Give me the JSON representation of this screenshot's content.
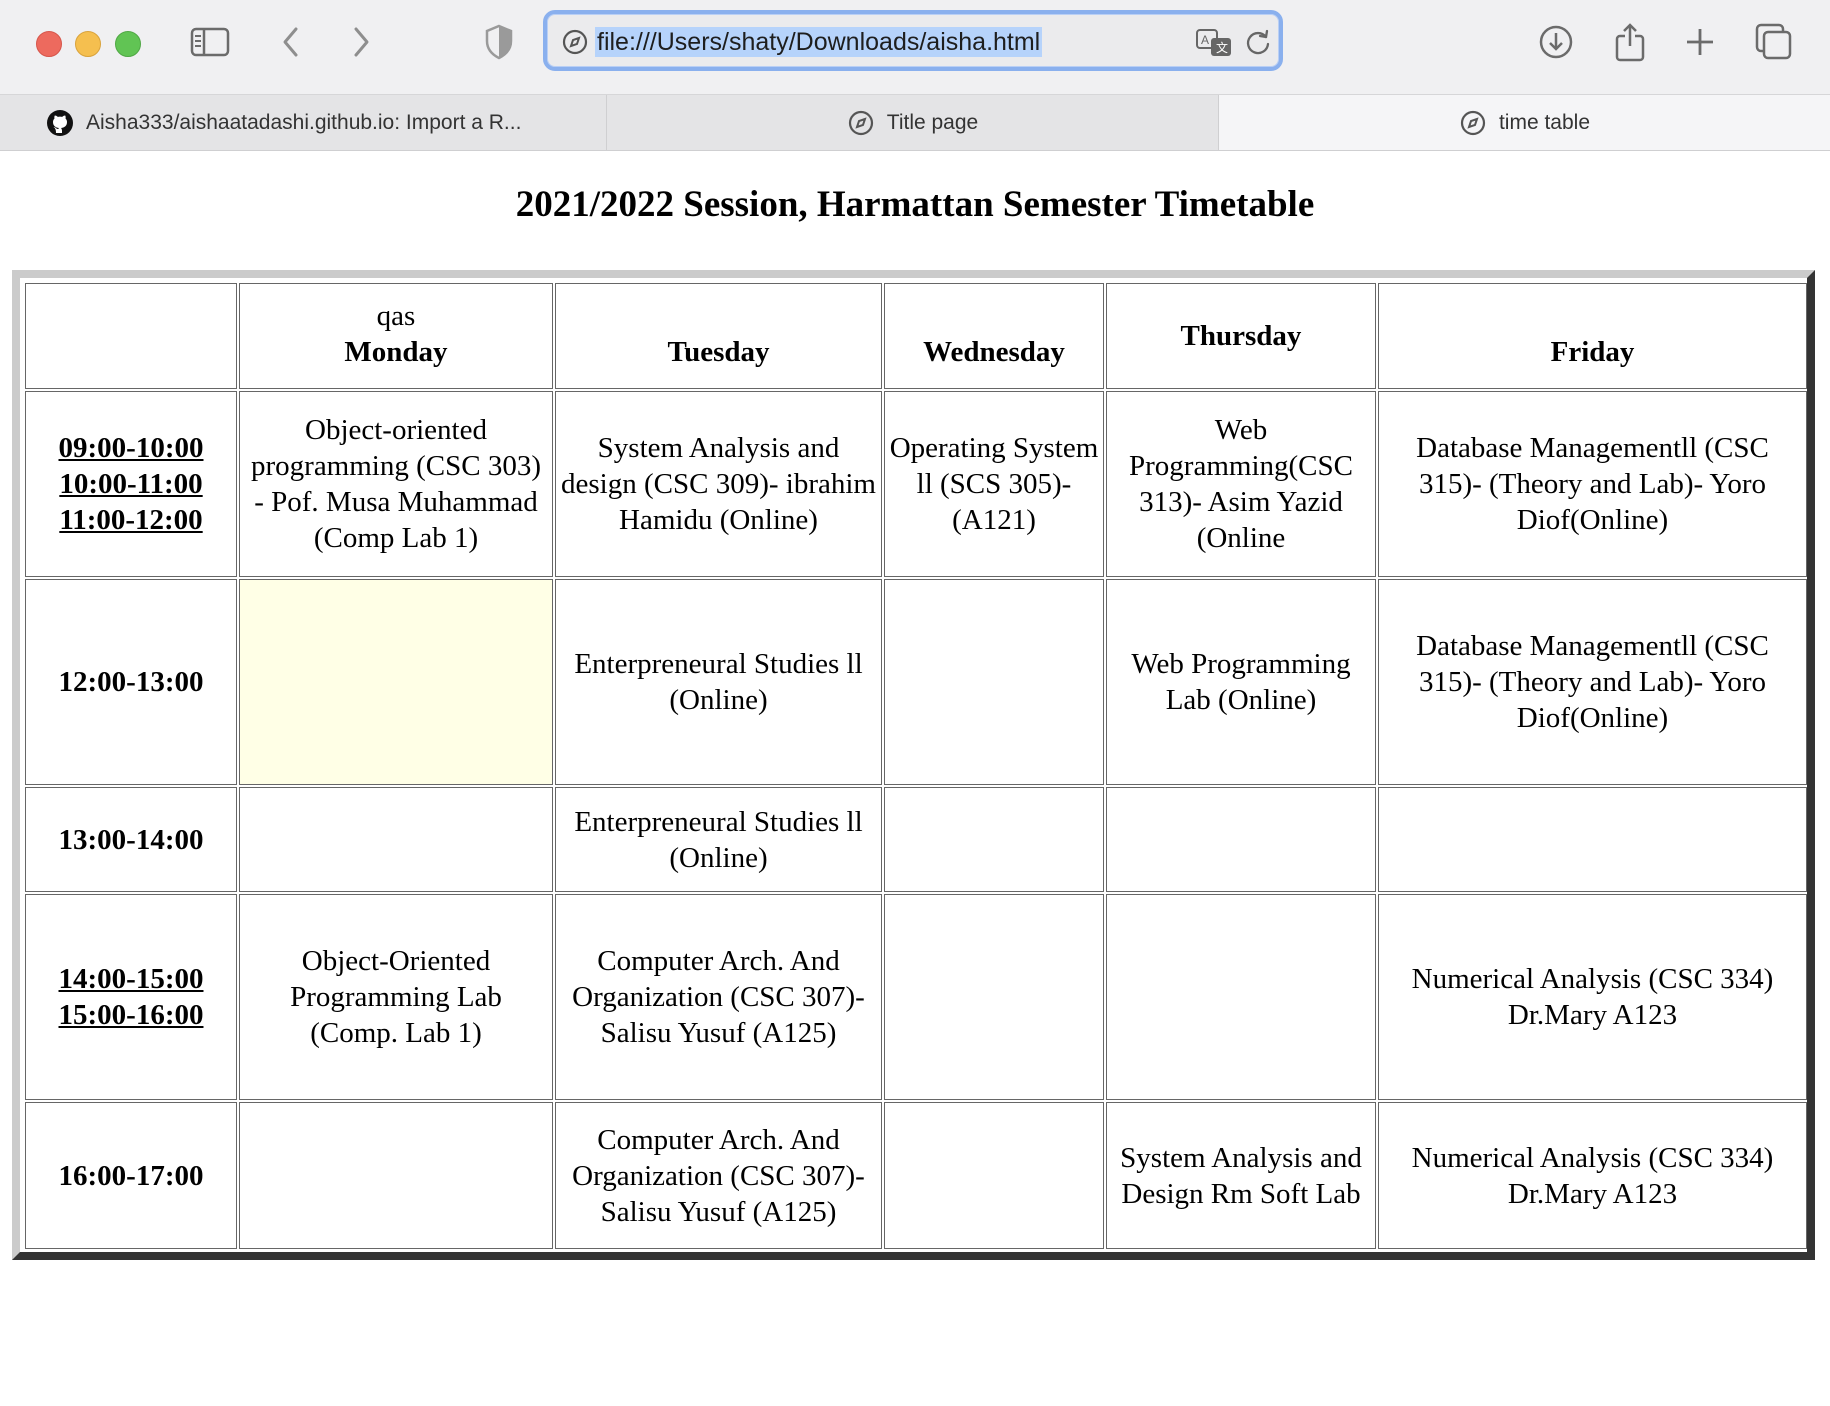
{
  "browser": {
    "url": "file:///Users/shaty/Downloads/aisha.html",
    "tabs": [
      {
        "label": "Aisha333/aishaatadashi.github.io: Import a R...",
        "icon": "github-icon",
        "active": false
      },
      {
        "label": "Title page",
        "icon": "compass-icon",
        "active": false
      },
      {
        "label": "time table",
        "icon": "compass-icon",
        "active": true
      }
    ]
  },
  "page": {
    "title": "2021/2022 Session, Harmattan Semester Timetable",
    "header": {
      "blank": "",
      "monday_note": "qas",
      "monday": "Monday",
      "tuesday": "Tuesday",
      "wednesday": "Wednesday",
      "thursday": "Thursday",
      "friday": "Friday"
    },
    "rows": [
      {
        "times": [
          "09:00-10:00",
          "10:00-11:00",
          "11:00-12:00"
        ],
        "linked": true,
        "cells": [
          "Object-oriented programming (CSC 303) - Pof. Musa Muhammad (Comp Lab 1)",
          "System Analysis and design (CSC 309)- ibrahim Hamidu (Online)",
          "Operating System ll (SCS 305)- (A121)",
          "Web Programming(CSC 313)- Asim Yazid (Online",
          "Database Managementll (CSC 315)- (Theory and Lab)- Yoro Diof(Online)"
        ]
      },
      {
        "times": [
          "12:00-13:00"
        ],
        "linked": false,
        "cells": [
          "",
          "Enterpreneural Studies ll (Online)",
          "",
          "Web Programming Lab (Online)",
          "Database Managementll (CSC 315)- (Theory and Lab)- Yoro Diof(Online)"
        ]
      },
      {
        "times": [
          "13:00-14:00"
        ],
        "linked": false,
        "cells": [
          "",
          "Enterpreneural Studies ll (Online)",
          "",
          "",
          ""
        ]
      },
      {
        "times": [
          "14:00-15:00",
          "15:00-16:00"
        ],
        "linked": true,
        "cells": [
          "Object-Oriented Programming Lab (Comp. Lab 1)",
          "Computer Arch. And Organization (CSC 307)- Salisu Yusuf (A125)",
          "",
          "",
          "Numerical Analysis (CSC 334) Dr.Mary A123"
        ]
      },
      {
        "times": [
          "16:00-17:00"
        ],
        "linked": false,
        "cells": [
          "",
          "Computer Arch. And Organization (CSC 307)- Salisu Yusuf (A125)",
          "",
          "System Analysis and Design Rm Soft Lab",
          "Numerical Analysis (CSC 334) Dr.Mary A123"
        ]
      }
    ],
    "highlight_color": "#ffffe6"
  }
}
